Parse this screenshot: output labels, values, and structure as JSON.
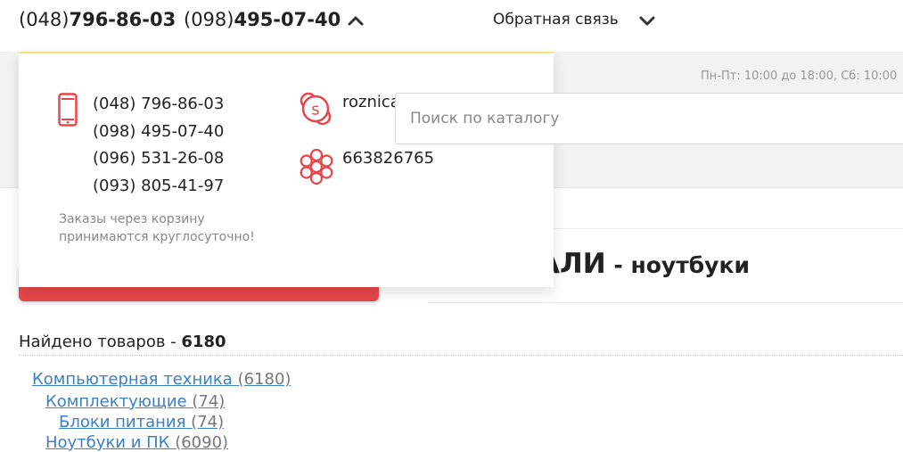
{
  "topbar": {
    "phone1_prefix": "(048)",
    "phone1_number": "796-86-03",
    "phone2_prefix": "(098)",
    "phone2_number": "495-07-40",
    "feedback_label": "Обратная связь"
  },
  "header": {
    "hours": "Пн-Пт: 10:00 до 18:00, Сб: 10:00",
    "search_placeholder": "Поиск по каталогу"
  },
  "popup": {
    "phones": [
      "(048) 796-86-03",
      "(098) 495-07-40",
      "(096) 531-26-08",
      "(093) 805-41-97"
    ],
    "note_line1": "Заказы через корзину",
    "note_line2": "принимаются круглосуточно!",
    "skype": "roznica",
    "icq": "663826765"
  },
  "main": {
    "title_big": "АЛИ",
    "title_dash": " - ",
    "title_small": "ноутбуки",
    "found_label": "Найдено товаров - ",
    "found_count": "6180"
  },
  "categories": [
    {
      "name": "Компьютерная техника",
      "count": "(6180)"
    },
    {
      "name": "Комплектующие",
      "count": "(74)"
    },
    {
      "name": "Блоки питания",
      "count": "(74)"
    },
    {
      "name": "Ноутбуки и ПК",
      "count": "(6090)"
    }
  ]
}
